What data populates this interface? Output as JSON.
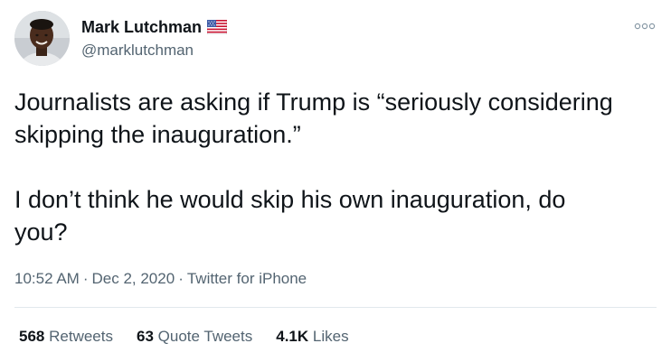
{
  "author": {
    "display_name": "Mark Lutchman",
    "handle": "@marklutchman",
    "badge_icon": "us-flag-icon",
    "avatar_icon": "avatar-photo"
  },
  "tweet": {
    "text": "Journalists are asking if Trump is “seriously considering\nskipping the inauguration.”\n\nI don’t think he would skip his own inauguration, do\nyou?",
    "time": "10:52 AM",
    "date": "Dec 2, 2020",
    "source": "Twitter for iPhone",
    "separator": "·"
  },
  "stats": {
    "retweets": {
      "count": "568",
      "label": "Retweets"
    },
    "quote_tweets": {
      "count": "63",
      "label": "Quote Tweets"
    },
    "likes": {
      "count": "4.1K",
      "label": "Likes"
    }
  },
  "menu": {
    "more_icon": "more-options-icon"
  },
  "colors": {
    "text_primary": "#0f1419",
    "text_secondary": "#536471",
    "divider": "#e1e8ed",
    "background": "#ffffff"
  }
}
